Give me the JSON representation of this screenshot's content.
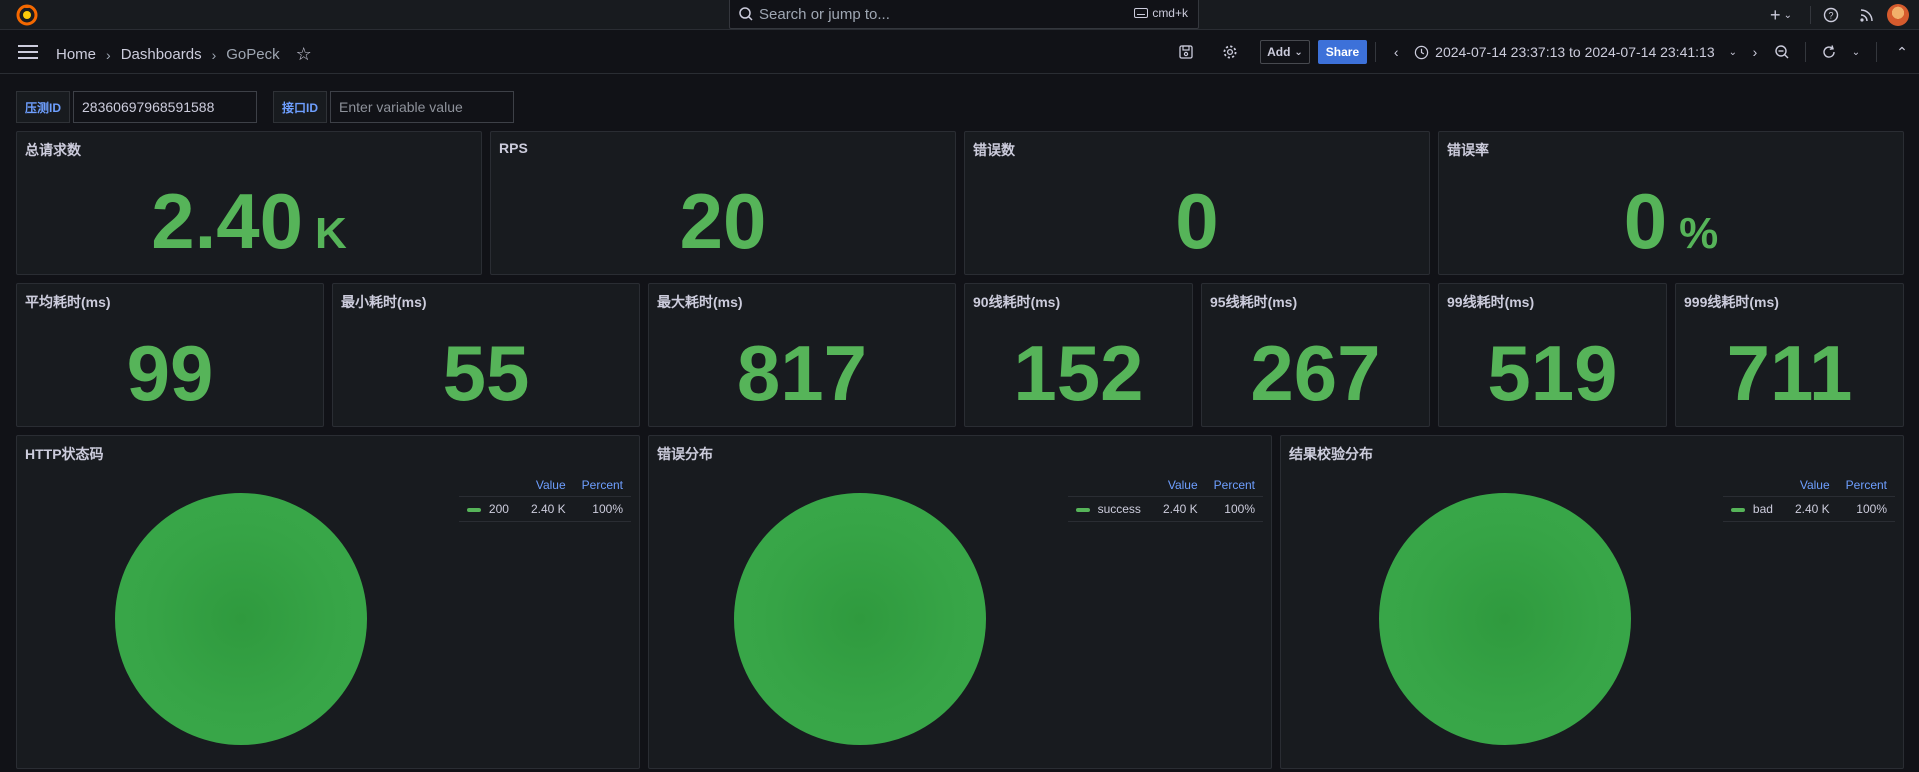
{
  "topbar": {
    "search_placeholder": "Search or jump to...",
    "shortcut": "cmd+k",
    "add_icon": "plus-icon",
    "help_icon": "help-icon",
    "news_icon": "rss-icon"
  },
  "nav": {
    "breadcrumbs": [
      "Home",
      "Dashboards",
      "GoPeck"
    ],
    "add_label": "Add",
    "share_label": "Share",
    "time_range": "2024-07-14 23:37:13 to 2024-07-14 23:41:13"
  },
  "variables": [
    {
      "label": "压测ID",
      "value": "28360697968591588",
      "placeholder": ""
    },
    {
      "label": "接口ID",
      "value": "",
      "placeholder": "Enter variable value"
    }
  ],
  "stats_row1": [
    {
      "title": "总请求数",
      "value": "2.40",
      "unit": "K"
    },
    {
      "title": "RPS",
      "value": "20",
      "unit": ""
    },
    {
      "title": "错误数",
      "value": "0",
      "unit": ""
    },
    {
      "title": "错误率",
      "value": "0",
      "unit": "%"
    }
  ],
  "stats_row2": [
    {
      "title": "平均耗时(ms)",
      "value": "99"
    },
    {
      "title": "最小耗时(ms)",
      "value": "55"
    },
    {
      "title": "最大耗时(ms)",
      "value": "817"
    },
    {
      "title": "90线耗时(ms)",
      "value": "152"
    },
    {
      "title": "95线耗时(ms)",
      "value": "267"
    },
    {
      "title": "99线耗时(ms)",
      "value": "519"
    },
    {
      "title": "999线耗时(ms)",
      "value": "711"
    }
  ],
  "pies": [
    {
      "title": "HTTP状态码",
      "legend_value": "Value",
      "legend_percent": "Percent",
      "series": "200",
      "value": "2.40 K",
      "percent": "100%"
    },
    {
      "title": "错误分布",
      "legend_value": "Value",
      "legend_percent": "Percent",
      "series": "success",
      "value": "2.40 K",
      "percent": "100%"
    },
    {
      "title": "结果校验分布",
      "legend_value": "Value",
      "legend_percent": "Percent",
      "series": "bad",
      "value": "2.40 K",
      "percent": "100%"
    }
  ],
  "colors": {
    "stat_green": "#56b459",
    "pie_green": "#37a547",
    "primary": "#3d71d9"
  }
}
